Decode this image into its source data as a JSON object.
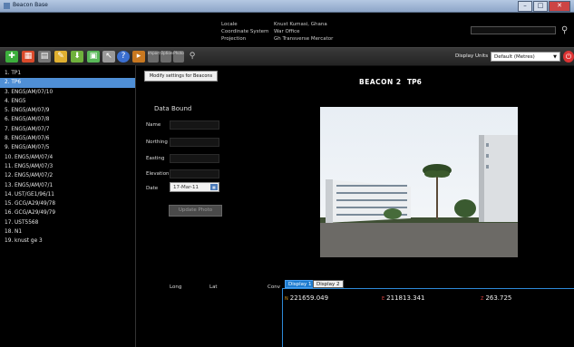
{
  "window": {
    "title": "Beacon Base"
  },
  "info": {
    "locale_label": "Locale",
    "locale_value": "Knust Kumasi, Ghana",
    "coord_system_label": "Coordinate System",
    "coord_system_value": "War Office",
    "projection_label": "Projection",
    "projection_value": "Gh Transverse Mercator"
  },
  "toolbar": {
    "display_units_label": "Display Units",
    "display_units_value": "Default (Metres)",
    "icons": [
      "add-icon",
      "record-icon",
      "document-icon",
      "edit-icon",
      "download-icon",
      "map-icon",
      "pointer-icon",
      "help-icon",
      "export-icon"
    ],
    "small_buttons": [
      "Import",
      "Options",
      "Photo"
    ]
  },
  "sidebar": {
    "items": [
      "1. TP1",
      "2. TP6",
      "3. ENG5/AM/07/10",
      "4. ENG5",
      "5. ENG5/AM/07/9",
      "6. ENG5/AM/07/8",
      "7. ENG5/AM/07/7",
      "8. ENG5/AM/07/6",
      "9. ENG5/AM/07/5",
      "10. ENG5/AM/07/4",
      "11. ENG5/AM/07/3",
      "12. ENG5/AM/07/2",
      "13. ENG5/AM/07/1",
      "14. UST/GE1/96/11",
      "15. GCG/A29/49/78",
      "16. GCG/A29/49/79",
      "17. UST5568",
      "18. N1",
      "19. knust ge 3"
    ],
    "selected_index": 1
  },
  "main": {
    "modify_button": "Modify settings for Beacons",
    "beacon_title": "BEACON 2",
    "beacon_name": "TP6",
    "data_bound_title": "Data Bound",
    "fields": {
      "name_label": "Name",
      "northing_label": "Northing",
      "easting_label": "Easting",
      "elevation_label": "Elevation",
      "date_label": "Date",
      "date_value": "17-Mar-11"
    },
    "update_button": "Update Photo"
  },
  "coords_header": {
    "long_label": "Long",
    "lat_label": "Lat",
    "conv_label": "Conv"
  },
  "display_panel": {
    "tabs": [
      "Display 1",
      "Display 2"
    ],
    "active_tab": 0,
    "n_key": "N",
    "n_value": "221659.049",
    "e_key": "E",
    "e_value": "211813.341",
    "z_key": "Z",
    "z_value": "263.725"
  },
  "colors": {
    "selected_item": "#4f8fd6",
    "active_tab": "#1e7cd0",
    "window_titlebar": "#a4b9d6"
  }
}
